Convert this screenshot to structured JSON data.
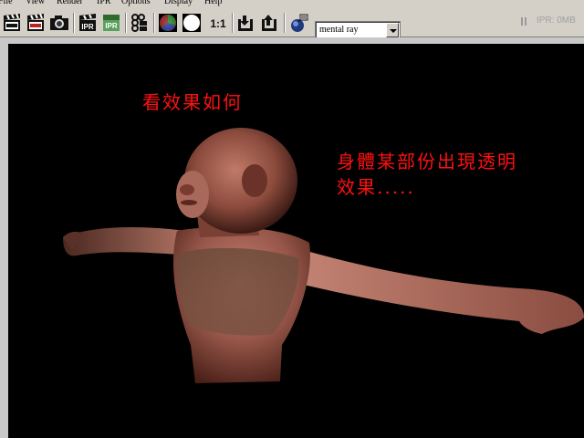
{
  "menu": {
    "items": [
      "File",
      "View",
      "Render",
      "IPR",
      "Options",
      "Display",
      "Help"
    ]
  },
  "toolbar": {
    "renderer": "mental ray",
    "ipr_status": "IPR: 0MB",
    "icons": [
      "clapboard-icon",
      "clapboard-red-icon",
      "camera-icon",
      "ipr-clapboard-icon",
      "ipr-green-icon",
      "channels-icon",
      "color-wheel-icon",
      "white-circle-icon",
      "one-to-one-icon",
      "keep-image-icon",
      "remove-image-icon",
      "render-globals-icon"
    ],
    "ratio_label": "1:1",
    "ipr_label": "IPR"
  },
  "viewport": {
    "caption_1": "看效果如何",
    "caption_2_line1": "身體某部份出現透明",
    "caption_2_line2": "效果....."
  }
}
